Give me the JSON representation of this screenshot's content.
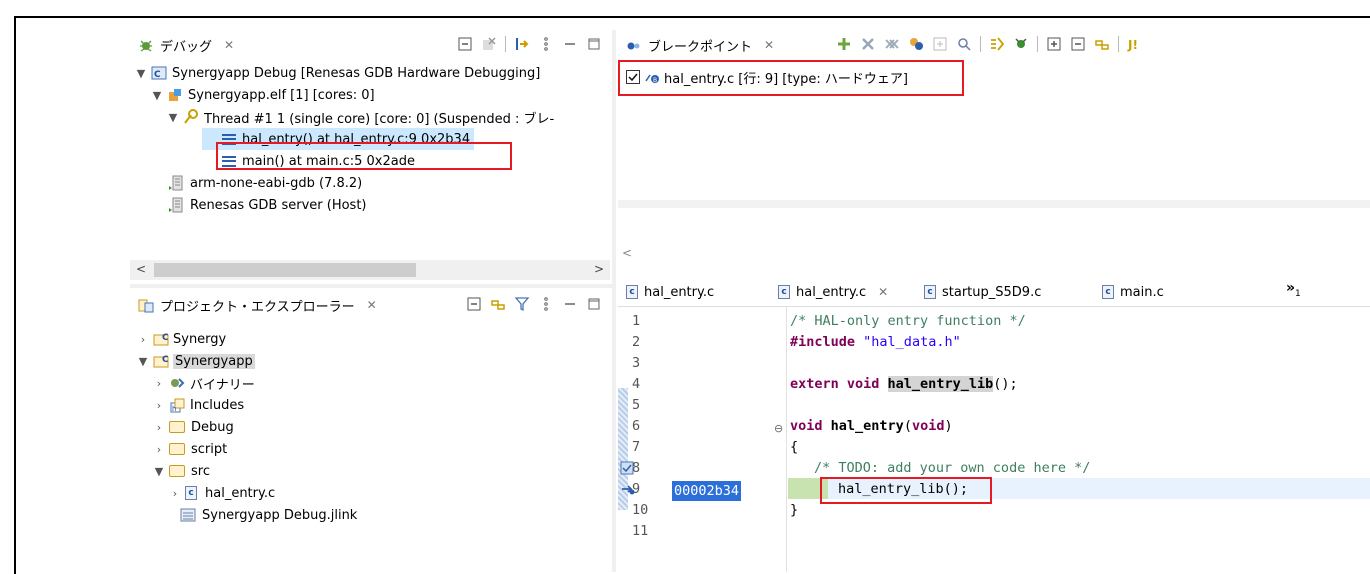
{
  "debug_view": {
    "title": "デバッグ",
    "tree": [
      {
        "text": "Synergyapp Debug [Renesas GDB Hardware Debugging]"
      },
      {
        "text": "Synergyapp.elf [1] [cores: 0]"
      },
      {
        "text": "Thread #1 1 (single core) [core: 0] (Suspended : ブレ-"
      },
      {
        "text": "hal_entry() at hal_entry.c:9 0x2b34"
      },
      {
        "text": "main() at main.c:5 0x2ade"
      },
      {
        "text": "arm-none-eabi-gdb (7.8.2)"
      },
      {
        "text": "Renesas GDB server (Host)"
      }
    ]
  },
  "breakpoints_view": {
    "title": "ブレークポイント",
    "items": [
      {
        "text": "hal_entry.c [行: 9] [type: ハードウェア]",
        "checked": true
      }
    ]
  },
  "project_explorer": {
    "title": "プロジェクト・エクスプローラー",
    "tree": [
      {
        "text": "Synergy"
      },
      {
        "text": "Synergyapp"
      },
      {
        "text": "バイナリー"
      },
      {
        "text": "Includes"
      },
      {
        "text": "Debug"
      },
      {
        "text": "script"
      },
      {
        "text": "src"
      },
      {
        "text": "hal_entry.c"
      },
      {
        "text": "Synergyapp Debug.jlink"
      }
    ]
  },
  "editor": {
    "tabs": [
      {
        "label": "hal_entry.c",
        "active": false
      },
      {
        "label": "hal_entry.c",
        "active": true
      },
      {
        "label": "startup_S5D9.c",
        "active": false
      },
      {
        "label": "main.c",
        "active": false
      }
    ],
    "overflow": "»",
    "overflow_count": "1",
    "line_numbers": [
      "1",
      "2",
      "3",
      "4",
      "5",
      "6",
      "7",
      "8",
      "9",
      "10",
      "11"
    ],
    "current_address": "00002b34",
    "code": {
      "l1": "/* HAL-only entry function */",
      "l2_kw": "#include",
      "l2_str": "\"hal_data.h\"",
      "l4_kw": "extern void",
      "l4_fn": "hal_entry_lib",
      "l4_tail": "();",
      "l6_kw": "void",
      "l6_fn": "hal_entry",
      "l6_paren": "(",
      "l6_arg": "void",
      "l6_tail": ")",
      "l7": "{",
      "l8": "/* TODO: add your own code here */",
      "l9": "hal_entry_lib();",
      "l10": "}"
    }
  },
  "colors": {
    "highlight_red": "#e41b24",
    "selection": "#cce8ff",
    "current_line": "#e8f2fe",
    "keyword": "#7f0055",
    "comment": "#3f7f5f",
    "string": "#2a00ff"
  }
}
